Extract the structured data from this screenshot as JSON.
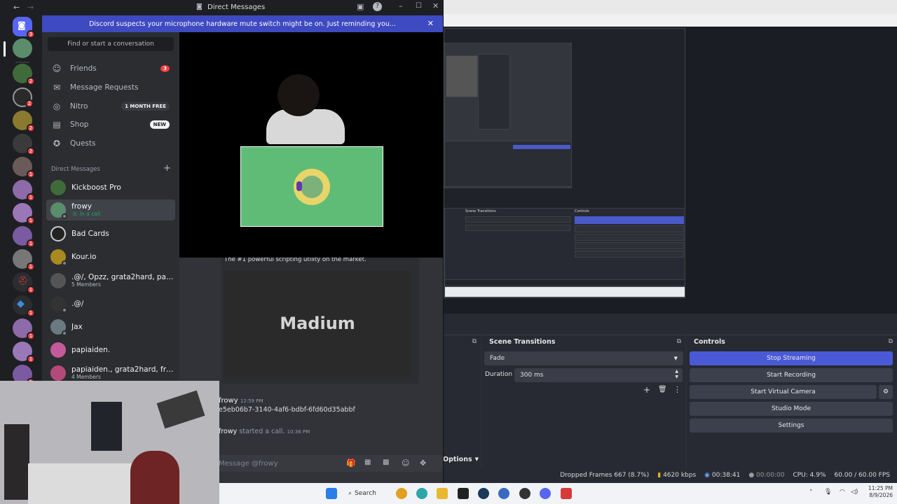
{
  "discord": {
    "window_title": "Direct Messages",
    "notice": "Discord suspects your microphone hardware mute switch might be on. Just reminding you...",
    "search_placeholder": "Find or start a conversation",
    "nav": {
      "friends": "Friends",
      "friends_badge": "3",
      "message_requests": "Message Requests",
      "nitro": "Nitro",
      "nitro_pill": "1 MONTH FREE",
      "shop": "Shop",
      "shop_pill": "NEW",
      "quests": "Quests"
    },
    "dm_header": "Direct Messages",
    "dms": [
      {
        "name": "Kickboost Pro",
        "sub": ""
      },
      {
        "name": "frowy",
        "sub": "In a call"
      },
      {
        "name": "Bad Cards",
        "sub": ""
      },
      {
        "name": "Kour.io",
        "sub": ""
      },
      {
        "name": ".@/, Opzz, grata2hard, papiai...",
        "sub": "5 Members"
      },
      {
        "name": ".@/",
        "sub": ""
      },
      {
        "name": "Jax",
        "sub": ""
      },
      {
        "name": "papiaiden.",
        "sub": ""
      },
      {
        "name": "papiaiden., grata2hard, frowy",
        "sub": "4 Members"
      }
    ],
    "guild_badges": [
      "",
      "",
      "2",
      "2",
      "2",
      "2",
      "1",
      "1",
      "1",
      "1",
      "1",
      "1",
      "1",
      "1",
      "1",
      "1",
      "1"
    ],
    "chat": {
      "embed_desc": "The #1 powerful scripting utility on the market.",
      "embed_title": "Madium",
      "author": "frowy",
      "time": "12:59 PM",
      "message": "e5eb06b7-3140-4af6-bdbf-6fd60d35abbf",
      "call_author": "frowy",
      "call_text": "started a call.",
      "call_time": "10:36 PM",
      "input_placeholder": "Message @frowy"
    }
  },
  "obs": {
    "scene_transitions_title": "Scene Transitions",
    "controls_title": "Controls",
    "transition": "Fade",
    "duration_label": "Duration",
    "duration_value": "300 ms",
    "options_label": "Options",
    "buttons": {
      "stop_streaming": "Stop Streaming",
      "start_recording": "Start Recording",
      "start_virtual_camera": "Start Virtual Camera",
      "studio_mode": "Studio Mode",
      "settings": "Settings"
    },
    "status": {
      "dropped": "Dropped Frames 667 (8.7%)",
      "bitrate": "4620 kbps",
      "stream_time": "00:38:41",
      "rec_time": "00:00:00",
      "cpu": "CPU: 4.9%",
      "fps": "60.00 / 60.00 FPS"
    }
  },
  "taskbar": {
    "search": "Search",
    "time": "11:25 PM",
    "date": "8/9/2026"
  },
  "colors": {
    "discord_blurple": "#5865f2",
    "obs_active": "#4a5ad6",
    "badge_red": "#f23f42"
  }
}
